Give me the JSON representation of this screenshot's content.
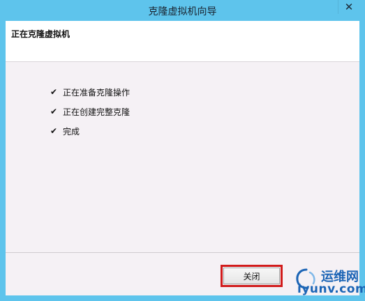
{
  "window": {
    "title": "克隆虚拟机向导",
    "close_glyph": "✕"
  },
  "header": {
    "title": "正在克隆虚拟机"
  },
  "steps": [
    {
      "label": "正在准备克隆操作",
      "status": "done"
    },
    {
      "label": "正在创建完整克隆",
      "status": "done"
    },
    {
      "label": "完成",
      "status": "done"
    }
  ],
  "footer": {
    "close_label": "关闭"
  },
  "watermark": {
    "text_cn": "运维网",
    "text_en": "iyunv.com"
  },
  "colors": {
    "frame": "#5ec4ec",
    "client_bg": "#f5f1f5",
    "highlight": "#d11b1b",
    "watermark": "#1b64b5"
  },
  "icons": {
    "step_status": "checkmark-icon",
    "close": "close-icon",
    "watermark_logo": "swirl-logo-icon"
  }
}
